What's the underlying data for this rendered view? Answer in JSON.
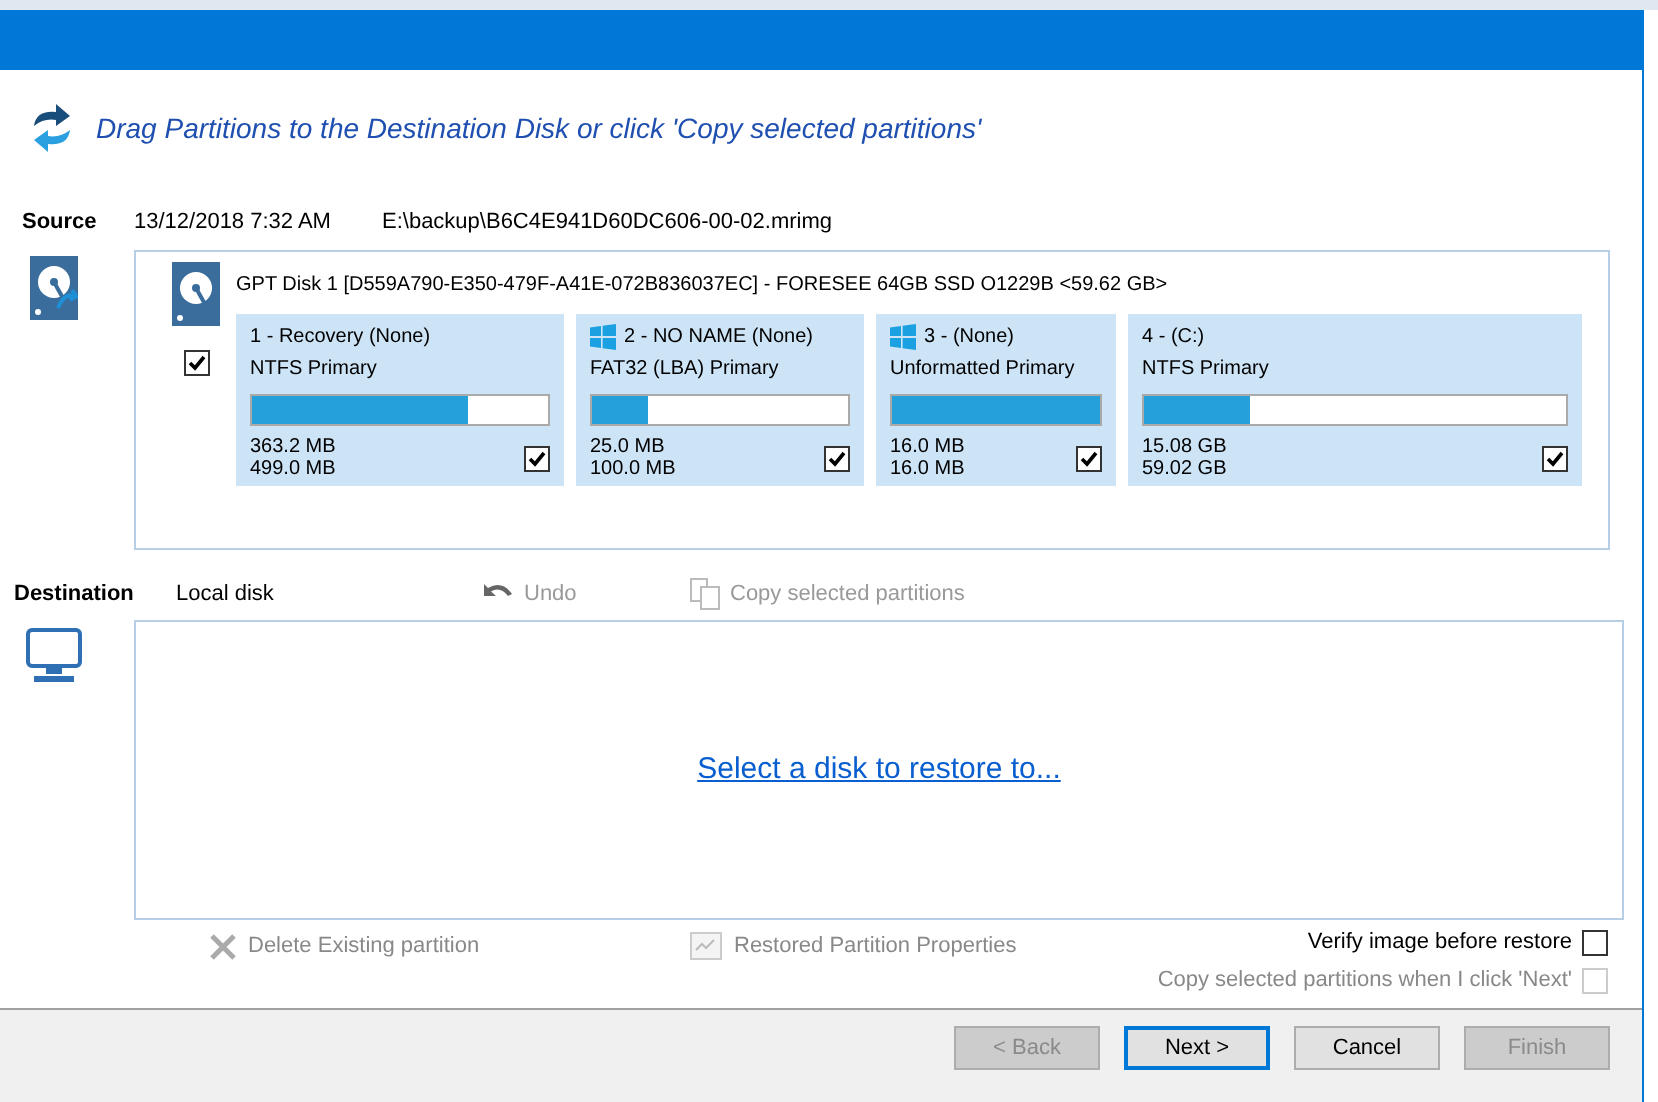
{
  "header": {
    "instruction": "Drag Partitions to the Destination Disk or click 'Copy selected partitions'"
  },
  "source": {
    "label": "Source",
    "date": "13/12/2018 7:32 AM",
    "path": "E:\\backup\\B6C4E941D60DC606-00-02.mrimg",
    "disk": {
      "title": "GPT Disk 1 [D559A790-E350-479F-A41E-072B836037EC] - FORESEE 64GB SSD O1229B  <59.62 GB>",
      "checked": true,
      "partitions": [
        {
          "name": "1 - Recovery (None)",
          "type": "NTFS Primary",
          "used": "363.2 MB",
          "total": "499.0 MB",
          "level": 0.73,
          "windows": false,
          "checked": true
        },
        {
          "name": "2 - NO NAME (None)",
          "type": "FAT32 (LBA) Primary",
          "used": "25.0 MB",
          "total": "100.0 MB",
          "level": 0.22,
          "windows": true,
          "checked": true
        },
        {
          "name": "3 -  (None)",
          "type": "Unformatted Primary",
          "used": "16.0 MB",
          "total": "16.0 MB",
          "level": 1.0,
          "windows": true,
          "checked": true
        },
        {
          "name": "4 -  (C:)",
          "type": "NTFS Primary",
          "used": "15.08 GB",
          "total": "59.02 GB",
          "level": 0.25,
          "windows": false,
          "checked": true
        }
      ]
    }
  },
  "destination": {
    "label": "Destination",
    "disk": "Local disk",
    "undo": {
      "label": "Undo",
      "disabled": true
    },
    "copy": {
      "label": "Copy selected partitions",
      "disabled": true
    },
    "link": "Select a disk to restore to..."
  },
  "actions": [
    {
      "label": "Delete Existing partition",
      "disabled": true
    },
    {
      "label": "Restored Partition Properties",
      "disabled": true
    }
  ],
  "options": [
    {
      "label": "Verify image before restore",
      "checked": false,
      "disabled": false
    },
    {
      "label": "Copy selected partitions when I click 'Next'",
      "checked": false,
      "disabled": true
    }
  ],
  "buttons": [
    {
      "label": "< Back",
      "disabled": true,
      "default": false
    },
    {
      "label": "Next >",
      "disabled": false,
      "default": true
    },
    {
      "label": "Cancel",
      "disabled": false,
      "default": false
    },
    {
      "label": "Finish",
      "disabled": true,
      "default": false
    }
  ]
}
